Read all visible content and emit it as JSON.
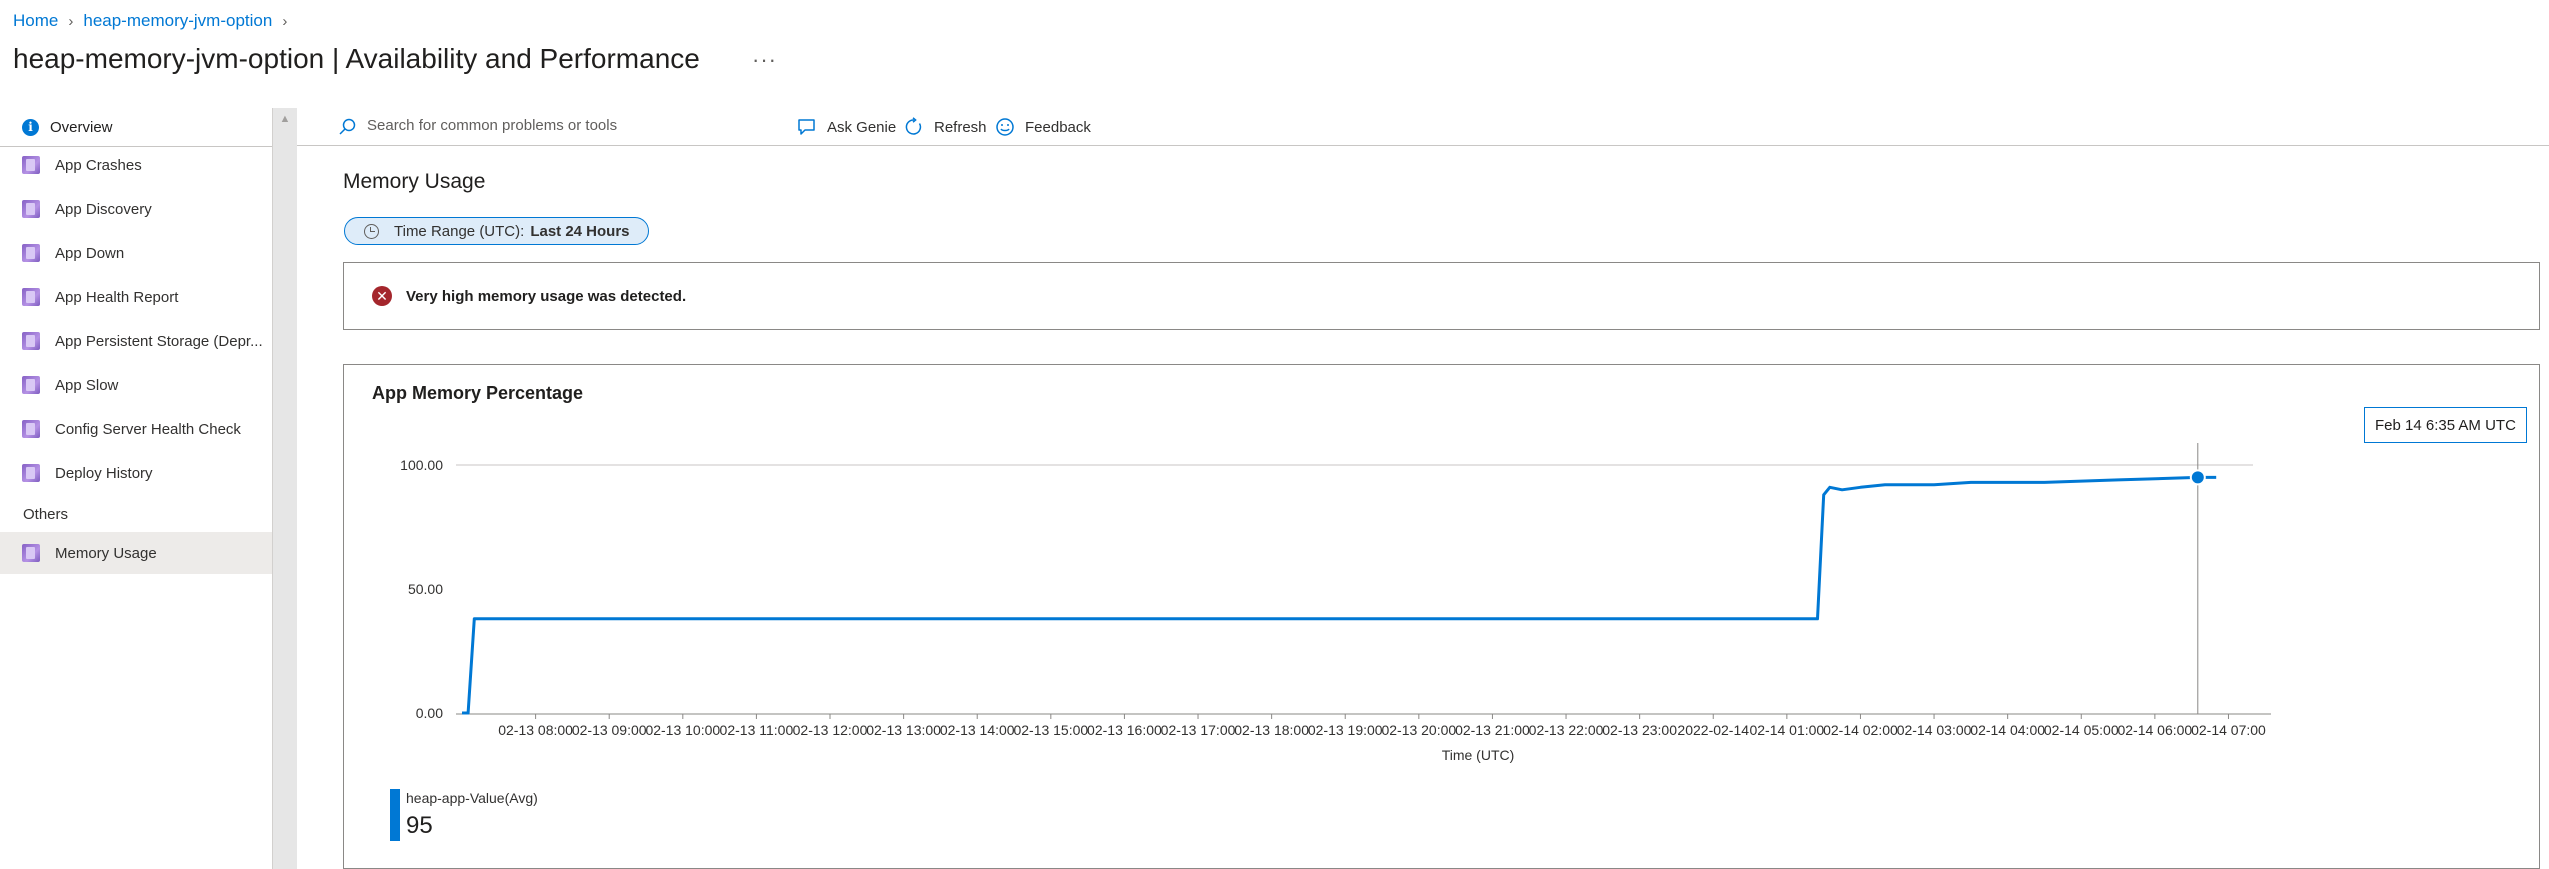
{
  "breadcrumb": {
    "items": [
      "Home",
      "heap-memory-jvm-option"
    ]
  },
  "page": {
    "title": "heap-memory-jvm-option | Availability and Performance",
    "more": "···"
  },
  "sidebar": {
    "overview_label": "Overview",
    "items": [
      {
        "label": "App Crashes",
        "icon": "book-icon"
      },
      {
        "label": "App Discovery",
        "icon": "book-icon"
      },
      {
        "label": "App Down",
        "icon": "book-icon"
      },
      {
        "label": "App Health Report",
        "icon": "book-icon"
      },
      {
        "label": "App Persistent Storage (Depr...",
        "icon": "book-icon"
      },
      {
        "label": "App Slow",
        "icon": "book-icon"
      },
      {
        "label": "Config Server Health Check",
        "icon": "book-icon"
      },
      {
        "label": "Deploy History",
        "icon": "book-icon"
      }
    ],
    "group_label": "Others",
    "group_items": [
      {
        "label": "Memory Usage",
        "icon": "book-icon",
        "active": true
      }
    ]
  },
  "toolbar": {
    "search_placeholder": "Search for common problems or tools",
    "ask_genie": "Ask Genie",
    "refresh": "Refresh",
    "feedback": "Feedback"
  },
  "main": {
    "section_title": "Memory Usage",
    "time_range_label": "Time Range (UTC):",
    "time_range_value": "Last 24 Hours",
    "alert_text": "Very high memory usage was detected.",
    "chart_title": "App Memory Percentage",
    "tooltip": "Feb 14 6:35 AM UTC",
    "legend_name": "heap-app-Value(Avg)",
    "legend_value": "95"
  },
  "colors": {
    "accent": "#0078d4",
    "error": "#a4262c",
    "icon_purple": "#8661c5"
  },
  "chart_data": {
    "type": "line",
    "title": "App Memory Percentage",
    "xlabel": "Time (UTC)",
    "ylabel": "",
    "ylim": [
      0,
      100
    ],
    "y_ticks": [
      "100.00",
      "50.00",
      "0.00"
    ],
    "x_ticks": [
      "02-13 08:00",
      "02-13 09:00",
      "02-13 10:00",
      "02-13 11:00",
      "02-13 12:00",
      "02-13 13:00",
      "02-13 14:00",
      "02-13 15:00",
      "02-13 16:00",
      "02-13 17:00",
      "02-13 18:00",
      "02-13 19:00",
      "02-13 20:00",
      "02-13 21:00",
      "02-13 22:00",
      "02-13 23:00",
      "2022-02-14",
      "02-14 01:00",
      "02-14 02:00",
      "02-14 03:00",
      "02-14 04:00",
      "02-14 05:00",
      "02-14 06:00",
      "02-14 07:00"
    ],
    "series": [
      {
        "name": "heap-app-Value(Avg)",
        "color": "#0078d4",
        "x": [
          "02-13 07:00",
          "02-13 07:05",
          "02-13 07:10",
          "02-14 01:25",
          "02-14 01:30",
          "02-14 01:35",
          "02-14 01:45",
          "02-14 02:00",
          "02-14 02:20",
          "02-14 03:00",
          "02-14 03:30",
          "02-14 04:30",
          "02-14 05:30",
          "02-14 06:35",
          "02-14 06:50"
        ],
        "values": [
          0,
          0,
          38,
          38,
          88,
          91,
          90,
          91,
          92,
          92,
          93,
          93,
          94,
          95,
          95
        ]
      }
    ],
    "highlight": {
      "x": "02-14 06:35",
      "value": 95
    },
    "grid": "horizontal",
    "legend": "bottom-left"
  }
}
